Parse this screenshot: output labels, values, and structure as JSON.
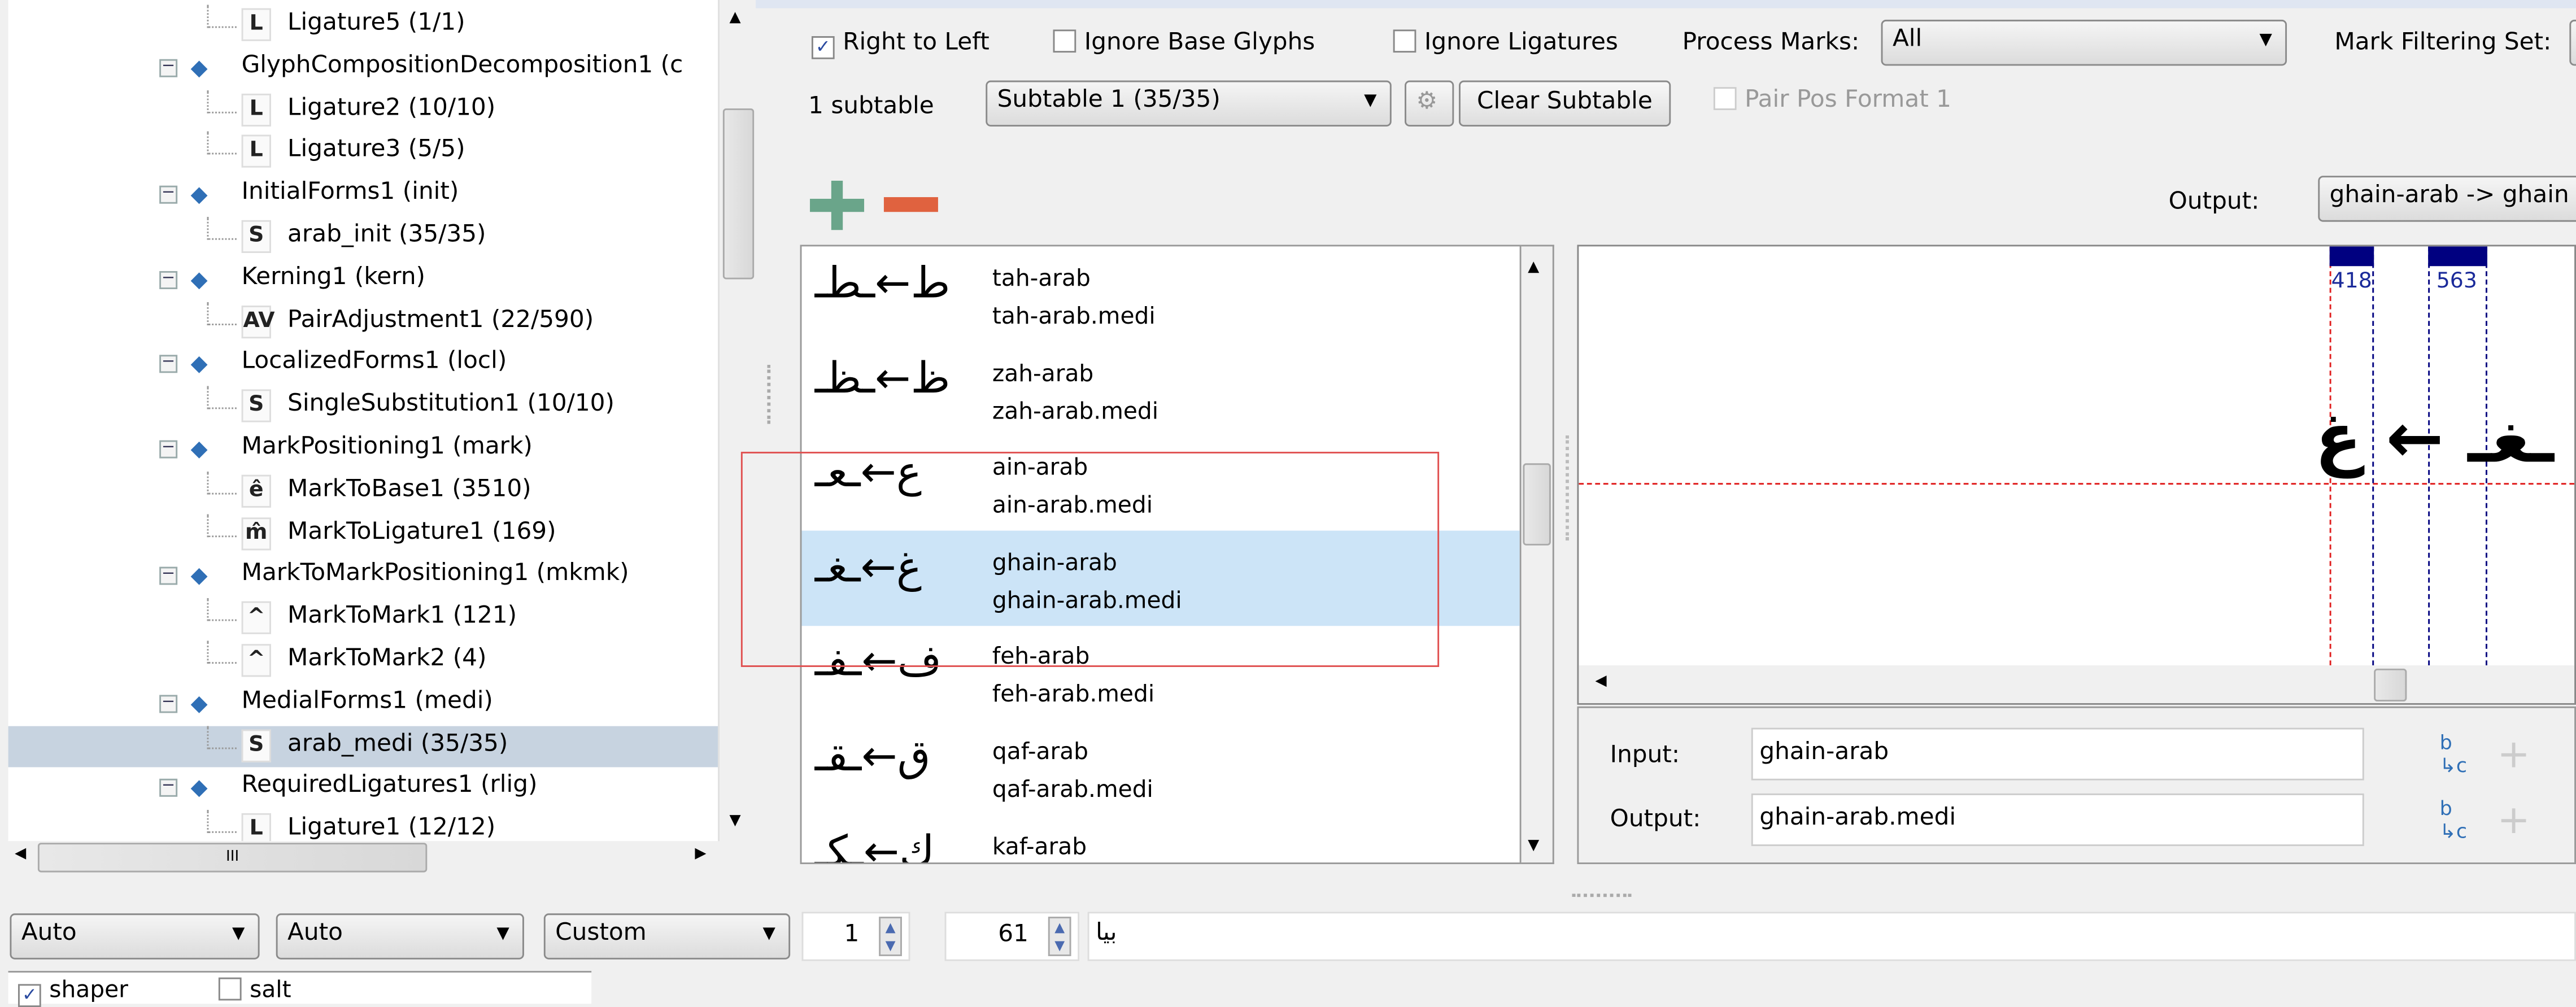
{
  "tree": {
    "items": [
      {
        "level": 2,
        "icon": "L",
        "label": "Ligature5 (1/1)"
      },
      {
        "level": 1,
        "label": "GlyphCompositionDecomposition1 (c"
      },
      {
        "level": 2,
        "icon": "L",
        "label": "Ligature2 (10/10)"
      },
      {
        "level": 2,
        "icon": "L",
        "label": "Ligature3 (5/5)"
      },
      {
        "level": 1,
        "label": "InitialForms1 (init)"
      },
      {
        "level": 2,
        "icon": "S",
        "label": "arab_init (35/35)"
      },
      {
        "level": 1,
        "label": "Kerning1 (kern)"
      },
      {
        "level": 2,
        "icon": "AV",
        "label": "PairAdjustment1 (22/590)"
      },
      {
        "level": 1,
        "label": "LocalizedForms1 (locl)"
      },
      {
        "level": 2,
        "icon": "S",
        "label": "SingleSubstitution1 (10/10)"
      },
      {
        "level": 1,
        "label": "MarkPositioning1 (mark)"
      },
      {
        "level": 2,
        "icon": "ê",
        "label": "MarkToBase1 (3510)"
      },
      {
        "level": 2,
        "icon": "m̂",
        "label": "MarkToLigature1 (169)"
      },
      {
        "level": 1,
        "label": "MarkToMarkPositioning1 (mkmk)"
      },
      {
        "level": 2,
        "icon": "^",
        "label": "MarkToMark1 (121)"
      },
      {
        "level": 2,
        "icon": "^",
        "label": "MarkToMark2 (4)"
      },
      {
        "level": 1,
        "label": "MedialForms1 (medi)"
      },
      {
        "level": 2,
        "icon": "S",
        "label": "arab_medi (35/35)",
        "selected": true
      },
      {
        "level": 1,
        "label": "RequiredLigatures1 (rlig)"
      },
      {
        "level": 2,
        "icon": "L",
        "label": "Ligature1 (12/12)"
      }
    ],
    "hscroll_thumb_label": "III"
  },
  "options": {
    "right_to_left": {
      "label": "Right to Left",
      "checked": true
    },
    "ignore_base": {
      "label": "Ignore Base Glyphs",
      "checked": false
    },
    "ignore_ligatures": {
      "label": "Ignore Ligatures",
      "checked": false
    },
    "process_marks_label": "Process Marks:",
    "process_marks_value": "All",
    "mark_filtering_label": "Mark Filtering Set:",
    "subtable_count": "1 subtable",
    "subtable_value": "Subtable 1 (35/35)",
    "clear_subtable": "Clear Subtable",
    "pair_pos_format": {
      "label": "Pair Pos Format 1",
      "checked": false,
      "disabled": true
    },
    "output_label": "Output:",
    "output_value": "ghain-arab -> ghain"
  },
  "glyph_list": [
    {
      "preview": "ط←ـطـ",
      "input": "tah-arab",
      "output": "tah-arab.medi"
    },
    {
      "preview": "ظ←ـظـ",
      "input": "zah-arab",
      "output": "zah-arab.medi"
    },
    {
      "preview": "ع←ـعـ",
      "input": "ain-arab",
      "output": "ain-arab.medi"
    },
    {
      "preview": "غ←ـغـ",
      "input": "ghain-arab",
      "output": "ghain-arab.medi",
      "selected": true
    },
    {
      "preview": "ف←ـفـ",
      "input": "feh-arab",
      "output": "feh-arab.medi"
    },
    {
      "preview": "ق←ـقـ",
      "input": "qaf-arab",
      "output": "qaf-arab.medi"
    },
    {
      "preview": "ك←ـكـ",
      "input": "kaf-arab",
      "output": ""
    }
  ],
  "preview": {
    "advance_widths": [
      "418",
      "563"
    ],
    "glyphs": "ـغـ ← غ",
    "colors": {
      "baseline": "#e02020",
      "advance": "#000080"
    }
  },
  "editor": {
    "input_label": "Input:",
    "input_value": "ghain-arab",
    "output_label": "Output:",
    "output_value": "ghain-arab.medi"
  },
  "bottom": {
    "script": "Auto",
    "language": "Auto",
    "mode": "Custom",
    "spin1": "1",
    "spin2": "61",
    "text": "بيا",
    "features": [
      {
        "label": "shaper",
        "checked": true
      },
      {
        "label": "salt",
        "checked": false
      }
    ]
  },
  "colors": {
    "add": "#6aa58a",
    "remove": "#e0623f",
    "selection": "#cce4f7",
    "tree_selection": "#c7d3e0"
  }
}
